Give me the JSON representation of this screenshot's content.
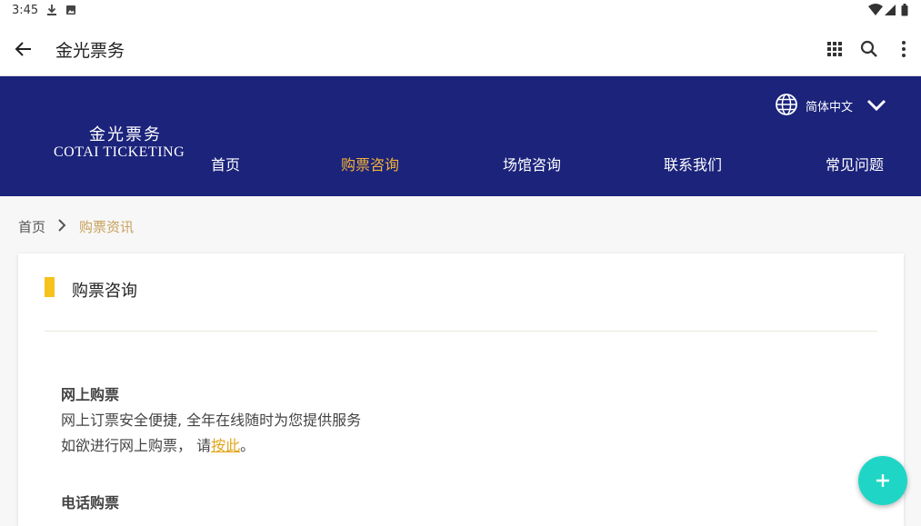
{
  "status_bar": {
    "time": "3:45"
  },
  "app_bar": {
    "title": "金光票务"
  },
  "header": {
    "logo_cn": "金光票务",
    "logo_en": "COTAI TICKETING",
    "language": "简体中文",
    "nav": [
      {
        "label": "首页",
        "active": false
      },
      {
        "label": "购票咨询",
        "active": true
      },
      {
        "label": "场馆咨询",
        "active": false
      },
      {
        "label": "联系我们",
        "active": false
      },
      {
        "label": "常见问题",
        "active": false
      }
    ]
  },
  "breadcrumb": {
    "home": "首页",
    "current": "购票资讯"
  },
  "content": {
    "section_title": "购票咨询",
    "online": {
      "title": "网上购票",
      "line1": "网上订票安全便捷, 全年在线随时为您提供服务",
      "line2_prefix": "如欲进行网上购票， 请",
      "line2_link": "按此",
      "line2_suffix": "。"
    },
    "phone": {
      "title": "电话购票"
    }
  },
  "colors": {
    "header_bg": "#1b237b",
    "nav_active": "#f5b335",
    "accent_bar": "#f6c21c",
    "breadcrumb_current": "#c8a05a",
    "link": "#e0a51a",
    "fab": "#1fd6c6"
  },
  "icons": {
    "status": [
      "download-icon",
      "image-icon",
      "wifi-icon",
      "signal-icon",
      "battery-icon"
    ],
    "app_bar": [
      "back-arrow-icon",
      "apps-grid-icon",
      "search-icon",
      "more-vert-icon"
    ],
    "header": [
      "globe-icon",
      "chevron-down-icon"
    ],
    "breadcrumb": "chevron-right-icon",
    "fab": "plus-icon"
  }
}
